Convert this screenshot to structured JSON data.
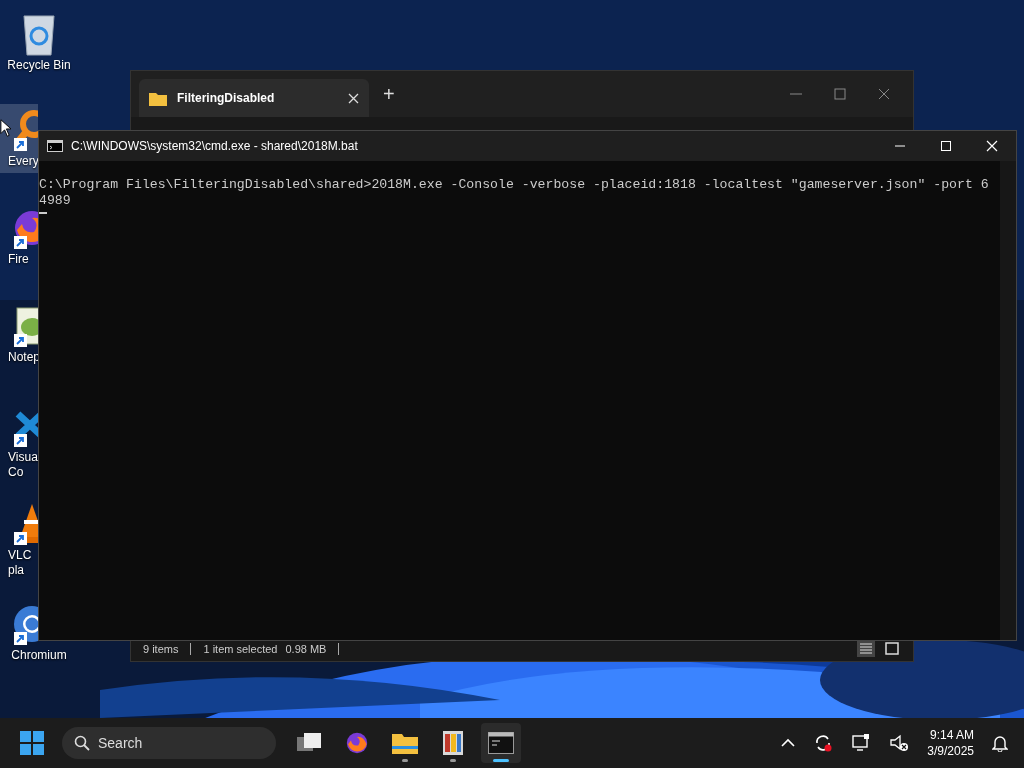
{
  "desktop_icons": [
    {
      "kind": "recycle",
      "label": [
        "Recycle Bin"
      ],
      "shortcut": false,
      "selected": false
    },
    {
      "kind": "everything",
      "label": [
        "Every"
      ],
      "shortcut": true,
      "selected": true
    },
    {
      "kind": "firefox",
      "label": [
        "Fire"
      ],
      "shortcut": true,
      "selected": false
    },
    {
      "kind": "notepad",
      "label": [
        "Notep"
      ],
      "shortcut": true,
      "selected": false
    },
    {
      "kind": "vscode",
      "label": [
        "Visual",
        "Co"
      ],
      "shortcut": true,
      "selected": false
    },
    {
      "kind": "vlc",
      "label": [
        "VLC",
        "pla"
      ],
      "shortcut": true,
      "selected": false
    },
    {
      "kind": "chromium",
      "label": [
        "Chromium"
      ],
      "shortcut": true,
      "selected": false
    }
  ],
  "explorer": {
    "tab": {
      "title": "FilteringDisabled",
      "selected": true
    },
    "new_tab": "+",
    "status": {
      "items": "9 items",
      "selection": "1 item selected",
      "size": "0.98 MB"
    }
  },
  "cmd": {
    "title": "C:\\WINDOWS\\system32\\cmd.exe - shared\\2018M.bat",
    "lines": [
      "C:\\Program Files\\FilteringDisabled\\shared>2018M.exe -Console -verbose -placeid:1818 -localtest \"gameserver.json\" -port 6",
      "4989"
    ]
  },
  "taskbar": {
    "search_placeholder": "Search",
    "apps": [
      {
        "kind": "taskview",
        "running": false,
        "focused": false
      },
      {
        "kind": "firefox",
        "running": false,
        "focused": false
      },
      {
        "kind": "explorer",
        "running": true,
        "focused": false
      },
      {
        "kind": "archive",
        "running": true,
        "focused": false
      },
      {
        "kind": "terminal",
        "running": true,
        "focused": true
      }
    ],
    "time": "9:14 AM",
    "date": "3/9/2025"
  }
}
